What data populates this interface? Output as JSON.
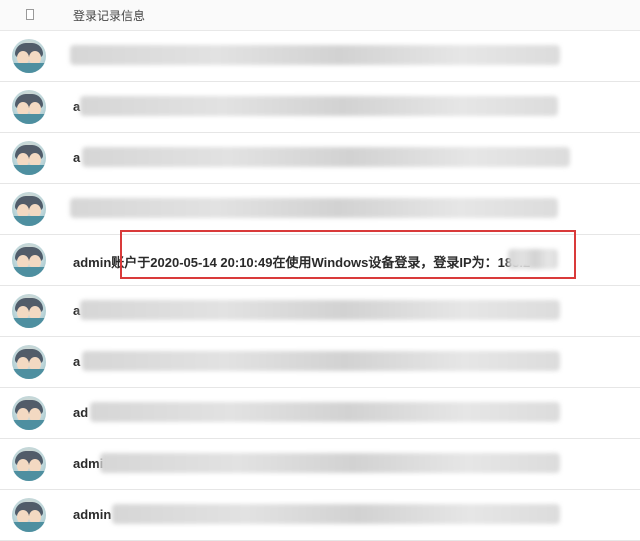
{
  "header": {
    "title": "登录记录信息",
    "checkbox_icon": "checkbox-icon"
  },
  "rows": [
    {
      "prefix": "",
      "visible_text": ""
    },
    {
      "prefix": "a",
      "visible_text": ""
    },
    {
      "prefix": "a",
      "visible_text": ""
    },
    {
      "prefix": "",
      "visible_text": ""
    },
    {
      "prefix": "admin",
      "visible_text": "账户于2020-05-14 20:10:49在使用Windows设备登录，登录IP为：183.2"
    },
    {
      "prefix": "a",
      "visible_text": ""
    },
    {
      "prefix": "a",
      "visible_text": ""
    },
    {
      "prefix": "ad",
      "visible_text": ""
    },
    {
      "prefix": "admi",
      "visible_text": ""
    },
    {
      "prefix": "admin",
      "visible_text": ""
    }
  ],
  "highlight": {
    "color": "#d93a3a"
  }
}
